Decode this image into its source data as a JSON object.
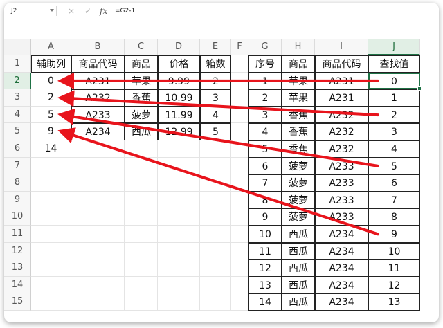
{
  "formula_bar": {
    "name_box": "J2",
    "cancel_icon": "×",
    "confirm_icon": "✓",
    "fx_icon": "fx",
    "formula": "=G2-1"
  },
  "columns": [
    "A",
    "B",
    "C",
    "D",
    "E",
    "F",
    "G",
    "H",
    "I",
    "J"
  ],
  "rows": [
    "1",
    "2",
    "3",
    "4",
    "5",
    "6",
    "7",
    "8",
    "9",
    "10",
    "11",
    "12",
    "13",
    "14",
    "15"
  ],
  "left_table": {
    "headers": [
      "辅助列",
      "商品代码",
      "商品",
      "价格",
      "箱数"
    ],
    "rows": [
      [
        "0",
        "A231",
        "苹果",
        "9.99",
        "2"
      ],
      [
        "2",
        "A232",
        "香蕉",
        "10.99",
        "3"
      ],
      [
        "5",
        "A233",
        "菠萝",
        "11.99",
        "4"
      ],
      [
        "9",
        "A234",
        "西瓜",
        "12.99",
        "5"
      ],
      [
        "14",
        "",
        "",
        "",
        ""
      ]
    ]
  },
  "right_table": {
    "headers": [
      "序号",
      "商品",
      "商品代码",
      "查找值"
    ],
    "rows": [
      [
        "1",
        "苹果",
        "A231",
        "0"
      ],
      [
        "2",
        "苹果",
        "A231",
        "1"
      ],
      [
        "3",
        "香蕉",
        "A232",
        "2"
      ],
      [
        "4",
        "香蕉",
        "A232",
        "3"
      ],
      [
        "5",
        "香蕉",
        "A232",
        "4"
      ],
      [
        "6",
        "菠萝",
        "A233",
        "5"
      ],
      [
        "7",
        "菠萝",
        "A233",
        "6"
      ],
      [
        "8",
        "菠萝",
        "A233",
        "7"
      ],
      [
        "9",
        "菠萝",
        "A233",
        "8"
      ],
      [
        "10",
        "西瓜",
        "A234",
        "9"
      ],
      [
        "11",
        "西瓜",
        "A234",
        "10"
      ],
      [
        "12",
        "西瓜",
        "A234",
        "11"
      ],
      [
        "13",
        "西瓜",
        "A234",
        "12"
      ],
      [
        "14",
        "西瓜",
        "A234",
        "13"
      ]
    ]
  },
  "colors": {
    "arrow": "#e8141c",
    "selection": "#1e7145"
  }
}
